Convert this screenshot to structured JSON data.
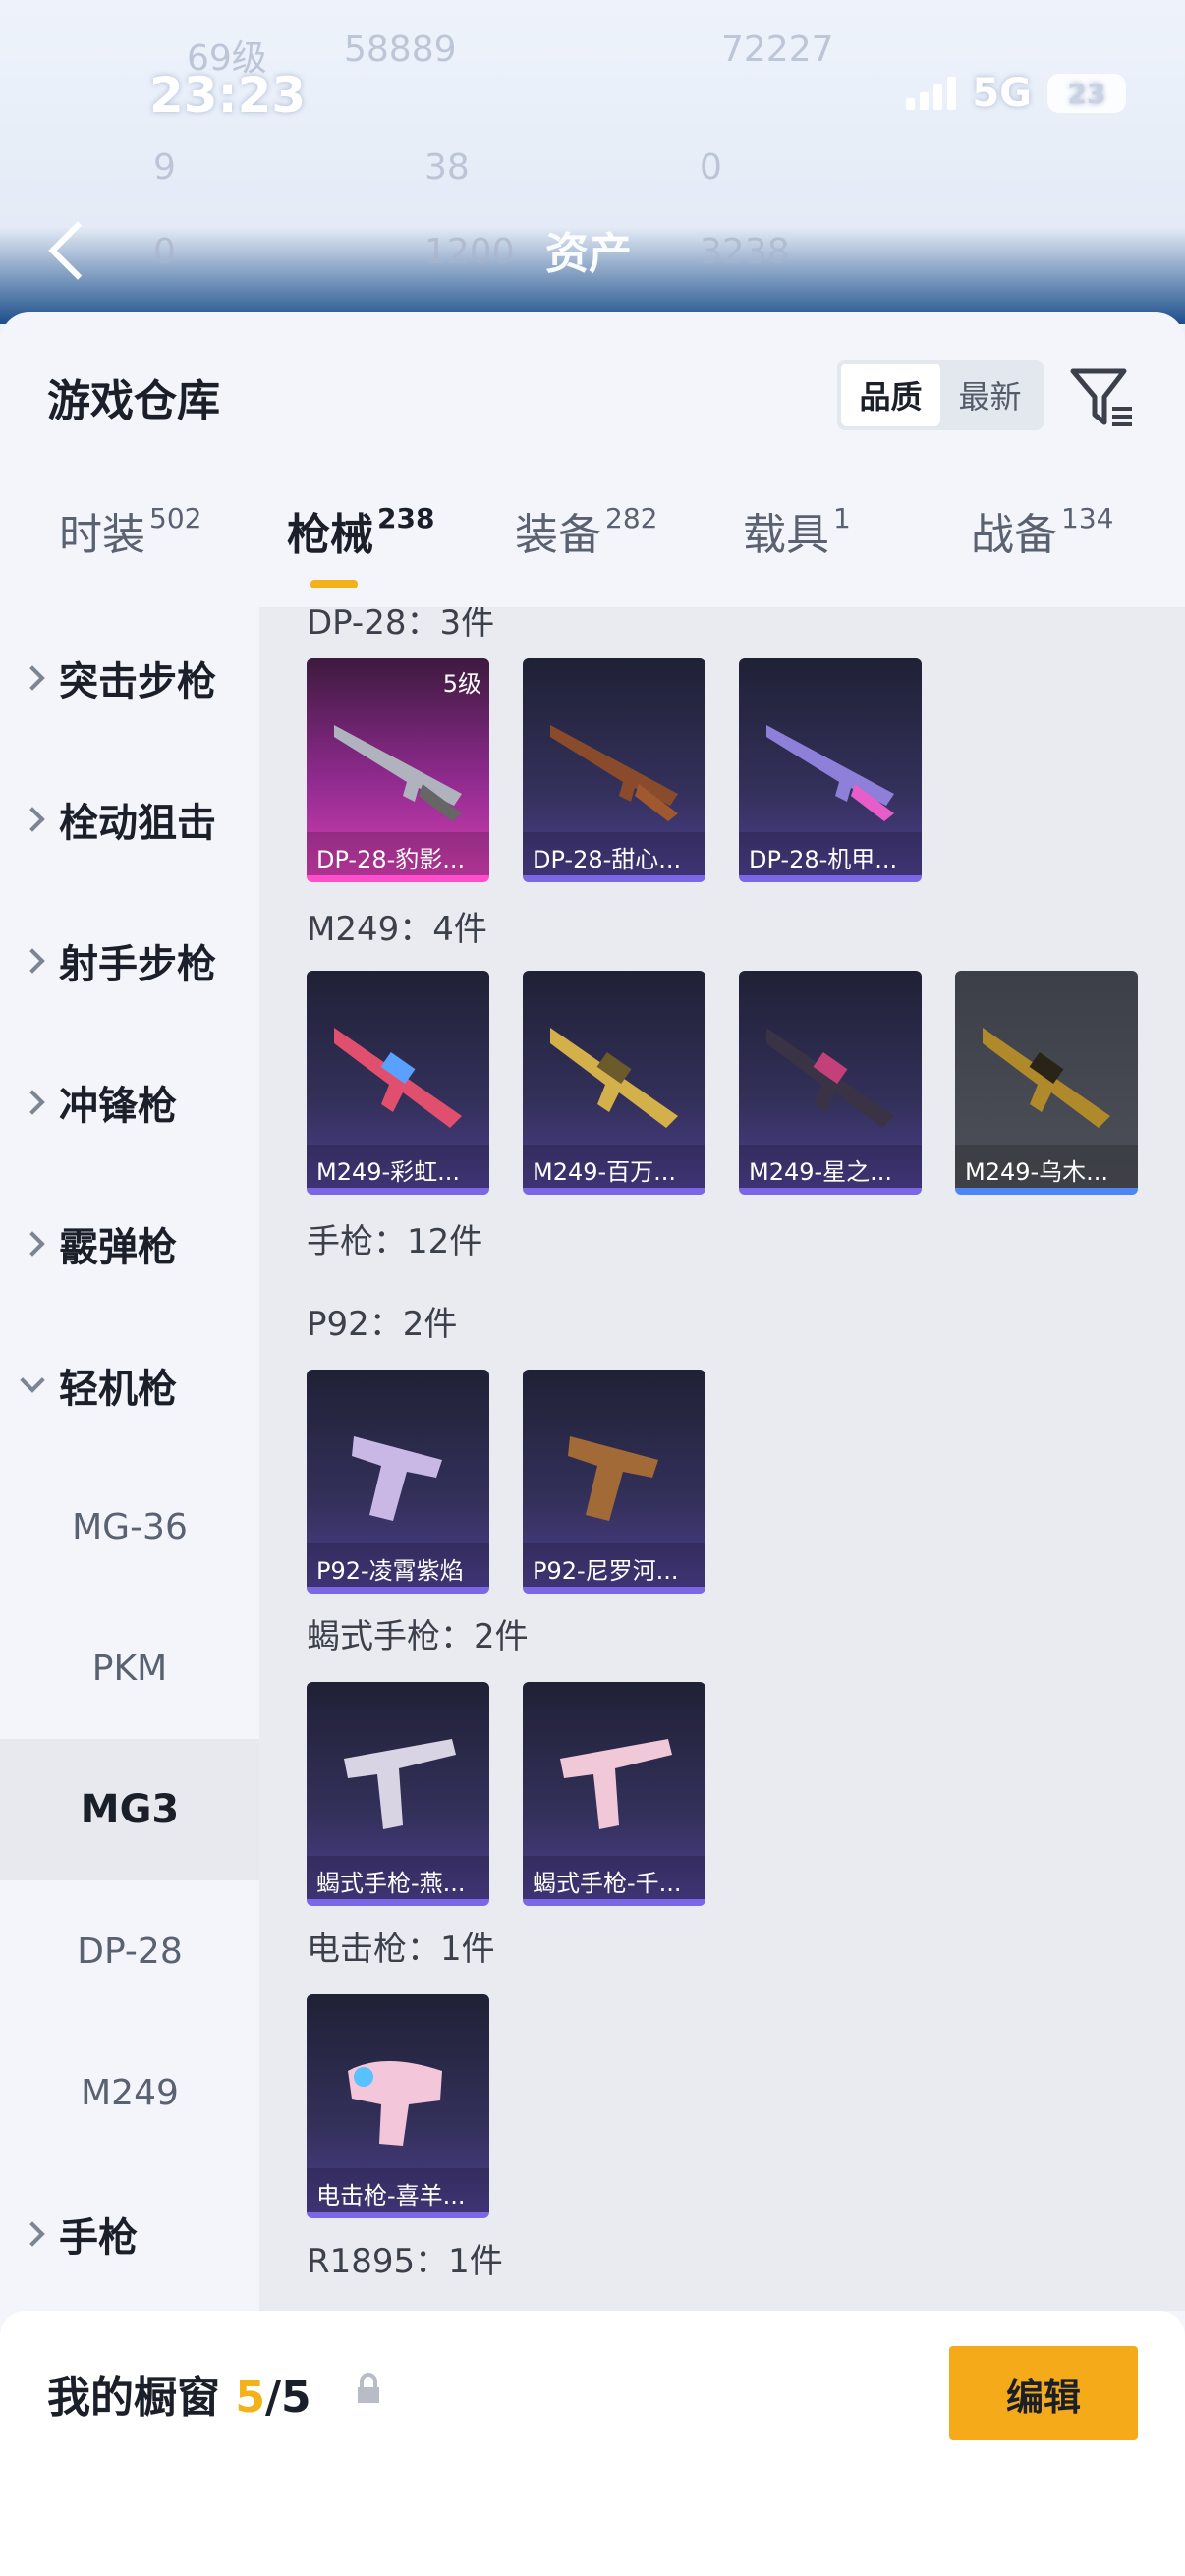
{
  "status_bar": {
    "time": "23:23",
    "network": "5G",
    "battery": "23"
  },
  "blurred_header": {
    "title": "资产",
    "stats": [
      "69级",
      "58889",
      "72227",
      "9",
      "38",
      "0",
      "0",
      "1200",
      "3238"
    ]
  },
  "sheet": {
    "title": "游戏仓库",
    "sort": [
      "品质",
      "最新"
    ],
    "tabs": [
      {
        "label": "时装",
        "count": "502"
      },
      {
        "label": "枪械",
        "count": "238"
      },
      {
        "label": "装备",
        "count": "282"
      },
      {
        "label": "载具",
        "count": "1"
      },
      {
        "label": "战备",
        "count": "134"
      }
    ]
  },
  "categories": [
    "突击步枪",
    "栓动狙击",
    "射手步枪",
    "冲锋枪",
    "霰弹枪",
    "轻机枪",
    "手枪"
  ],
  "subcategories": [
    "MG-36",
    "PKM",
    "MG3",
    "DP-28",
    "M249"
  ],
  "sections": {
    "dp28": {
      "title": "DP-28：3件",
      "cards": [
        {
          "name": "DP-28-豹影...",
          "level": "5级"
        },
        {
          "name": "DP-28-甜心..."
        },
        {
          "name": "DP-28-机甲..."
        }
      ]
    },
    "m249": {
      "title": "M249：4件",
      "cards": [
        {
          "name": "M249-彩虹..."
        },
        {
          "name": "M249-百万..."
        },
        {
          "name": "M249-星之..."
        },
        {
          "name": "M249-乌木..."
        }
      ]
    },
    "pistol": {
      "title": "手枪：12件"
    },
    "p92": {
      "title": "P92：2件",
      "cards": [
        {
          "name": "P92-凌霄紫焰"
        },
        {
          "name": "P92-尼罗河..."
        }
      ]
    },
    "scorpion": {
      "title": "蝎式手枪：2件",
      "cards": [
        {
          "name": "蝎式手枪-燕..."
        },
        {
          "name": "蝎式手枪-千..."
        }
      ]
    },
    "stun": {
      "title": "电击枪：1件",
      "cards": [
        {
          "name": "电击枪-喜羊..."
        }
      ]
    },
    "r1895": {
      "title": "R1895：1件"
    }
  },
  "showcase": {
    "label": "我的橱窗",
    "current": "5",
    "total": "/5",
    "edit": "编辑"
  }
}
